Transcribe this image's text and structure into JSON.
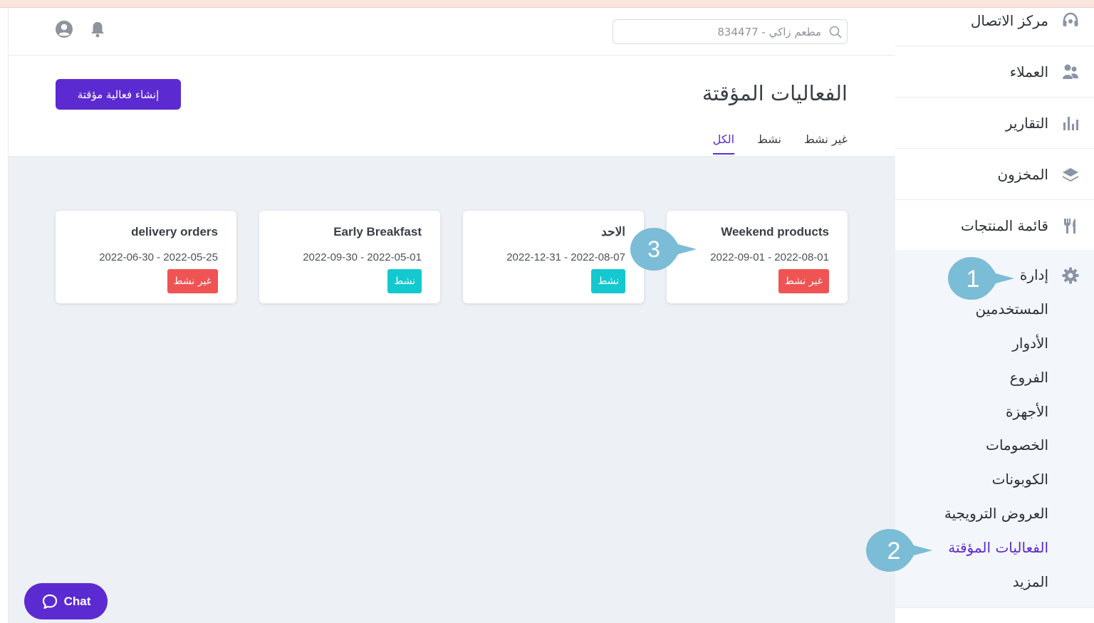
{
  "header": {
    "search_placeholder": "مطعم زاكي - 834477",
    "icons": [
      "bell-icon",
      "user-icon",
      "search-icon"
    ]
  },
  "page": {
    "title": "الفعاليات المؤقتة",
    "create_button": "إنشاء فعالية مؤقتة",
    "tabs": [
      {
        "label": "الكل",
        "active": true
      },
      {
        "label": "نشط",
        "active": false
      },
      {
        "label": "غير نشط",
        "active": false
      }
    ]
  },
  "events": [
    {
      "name": "Weekend products",
      "dates": "2022-09-01 - 2022-08-01",
      "status": "غير نشط",
      "status_color": "#ef5353"
    },
    {
      "name": "الاحد",
      "dates": "2022-12-31 - 2022-08-07",
      "status": "نشط",
      "status_color": "#13c8cf"
    },
    {
      "name": "Early Breakfast",
      "dates": "2022-09-30 - 2022-05-01",
      "status": "نشط",
      "status_color": "#13c8cf"
    },
    {
      "name": "delivery orders",
      "dates": "2022-06-30 - 2022-05-25",
      "status": "غير نشط",
      "status_color": "#ef5353"
    }
  ],
  "sidebar": {
    "items": [
      {
        "label": "مركز الاتصال",
        "icon": "headset-icon"
      },
      {
        "label": "العملاء",
        "icon": "users-icon"
      },
      {
        "label": "التقارير",
        "icon": "bar-chart-icon"
      },
      {
        "label": "المخزون",
        "icon": "layers-icon"
      },
      {
        "label": "قائمة المنتجات",
        "icon": "utensils-icon"
      }
    ],
    "admin": {
      "label": "إدارة",
      "icon": "gear-icon"
    },
    "admin_items": [
      {
        "label": "المستخدمين",
        "active": false
      },
      {
        "label": "الأدوار",
        "active": false
      },
      {
        "label": "الفروع",
        "active": false
      },
      {
        "label": "الأجهزة",
        "active": false
      },
      {
        "label": "الخصومات",
        "active": false
      },
      {
        "label": "الكوبونات",
        "active": false
      },
      {
        "label": "العروض الترويجية",
        "active": false
      },
      {
        "label": "الفعاليات المؤقتة",
        "active": true
      },
      {
        "label": "المزيد",
        "active": false
      }
    ]
  },
  "callouts": [
    "1",
    "2",
    "3"
  ],
  "chat": {
    "label": "Chat"
  },
  "colors": {
    "accent": "#5c2ad1",
    "active": "#13c8cf",
    "inactive": "#ef5353",
    "callout": "#7bbcd6"
  }
}
